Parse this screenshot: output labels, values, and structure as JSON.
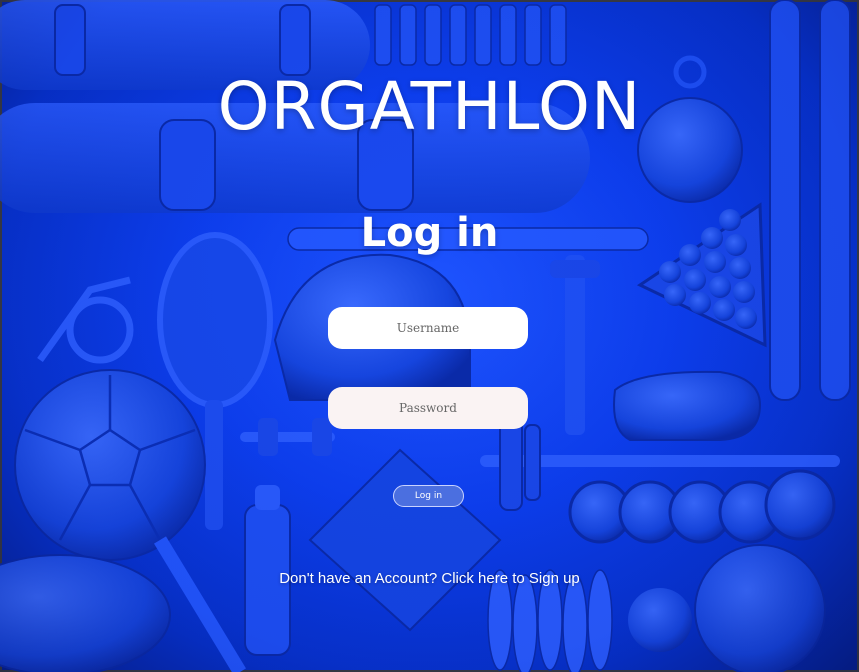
{
  "app": {
    "title": "ORGATHLON",
    "heading": "Log in"
  },
  "form": {
    "username_placeholder": "Username",
    "password_placeholder": "Password",
    "login_button": "Log in",
    "signup_link": "Don't have an Account? Click here to Sign up"
  },
  "theme": {
    "background": "#0d3ff0",
    "button": "#4b6fe0",
    "text": "#ffffff"
  }
}
